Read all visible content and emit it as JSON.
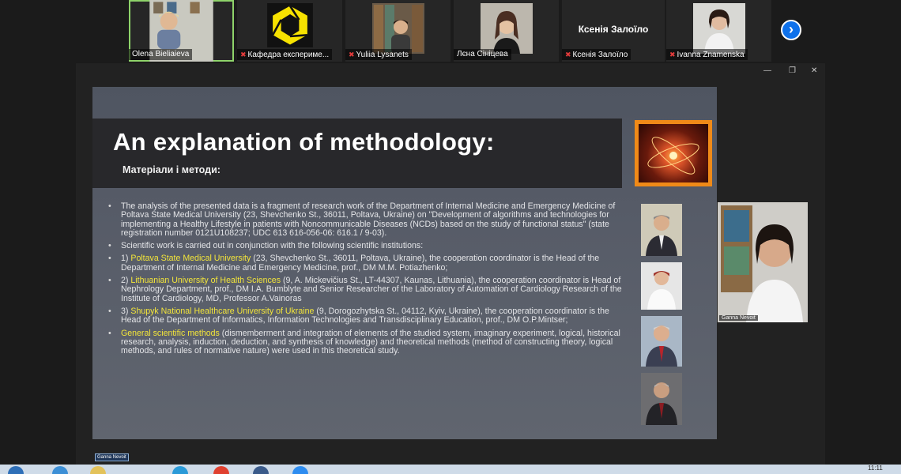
{
  "participants": [
    {
      "name": "Olena Bieliaieva",
      "muted": false
    },
    {
      "name": "Кафедра експериме...",
      "muted": true
    },
    {
      "name": "Yuliia Lysanets",
      "muted": true
    },
    {
      "name": "Лєна Сініцева",
      "muted": false
    },
    {
      "name": "Ксенія Залоїло",
      "muted": true,
      "big_name": "Ксенія Залоїло"
    },
    {
      "name": "Ivanna Znamenska",
      "muted": true
    }
  ],
  "slide": {
    "title": "An explanation of methodology:",
    "subtitle": "Матеріали і методи:",
    "bullets": {
      "b1": "The analysis of the presented data is a fragment of research work of the Department of Internal Medicine and Emergency Medicine of Poltava State Medical University (23, Shevchenko St., 36011, Poltava, Ukraine) on \"Development of algorithms and technologies for implementing a Healthy Lifestyle in patients with Noncommunicable Diseases (NCDs) based on the study of functional status\" (state registration number 0121U108237; UDC 613 616-056-06: 616.1 / 9-03).",
      "b2": "Scientific work is carried out in conjunction with the following scientific institutions:",
      "b3_prefix": "1) ",
      "b3_hl": "Poltava State Medical University",
      "b3_text": " (23, Shevchenko St., 36011, Poltava, Ukraine), the cooperation coordinator is the Head of the Department of Internal Medicine and Emergency Medicine, prof., DM M.M. Potiazhenko;",
      "b4_prefix": "2) ",
      "b4_hl": "Lithuanian University of Health Sciences",
      "b4_text": " (9, A. Mickevičius St., LT-44307, Kaunas, Lithuania), the cooperation coordinator is Head of Nephrology Department, prof., DM I.A. Bumblyte and Senior Researcher of the Laboratory of Automation of Cardiology Research of the Institute of Cardiology, MD, Professor A.Vainoras",
      "b5_prefix": "3) ",
      "b5_hl": "Shupyk National Healthcare University of Ukraine",
      "b5_text": " (9, Dorogozhytska St., 04112, Kyiv, Ukraine), the cooperation coordinator is the Head of the Department of Informatics, Information Technologies and Transdisciplinary Education, prof., DM O.P.Mintser;",
      "b6_hl": "General scientific methods",
      "b6_text": " (dismemberment and integration of elements of the studied system, imaginary experiment, logical, historical research, analysis, induction, deduction, and synthesis of knowledge) and theoretical methods (method of constructing theory, logical methods, and rules of normative nature) were used in this theoretical study."
    }
  },
  "speaker": {
    "name": "Ganna Nevoit"
  },
  "taskbar": {
    "tooltip": "Ganna Nevoit",
    "clock": "11:11"
  },
  "colors": {
    "active_tile": "#8ed36a",
    "accent_blue": "#0e71eb",
    "highlight": "#f3e53a",
    "slide_frame": "#f08a18"
  }
}
